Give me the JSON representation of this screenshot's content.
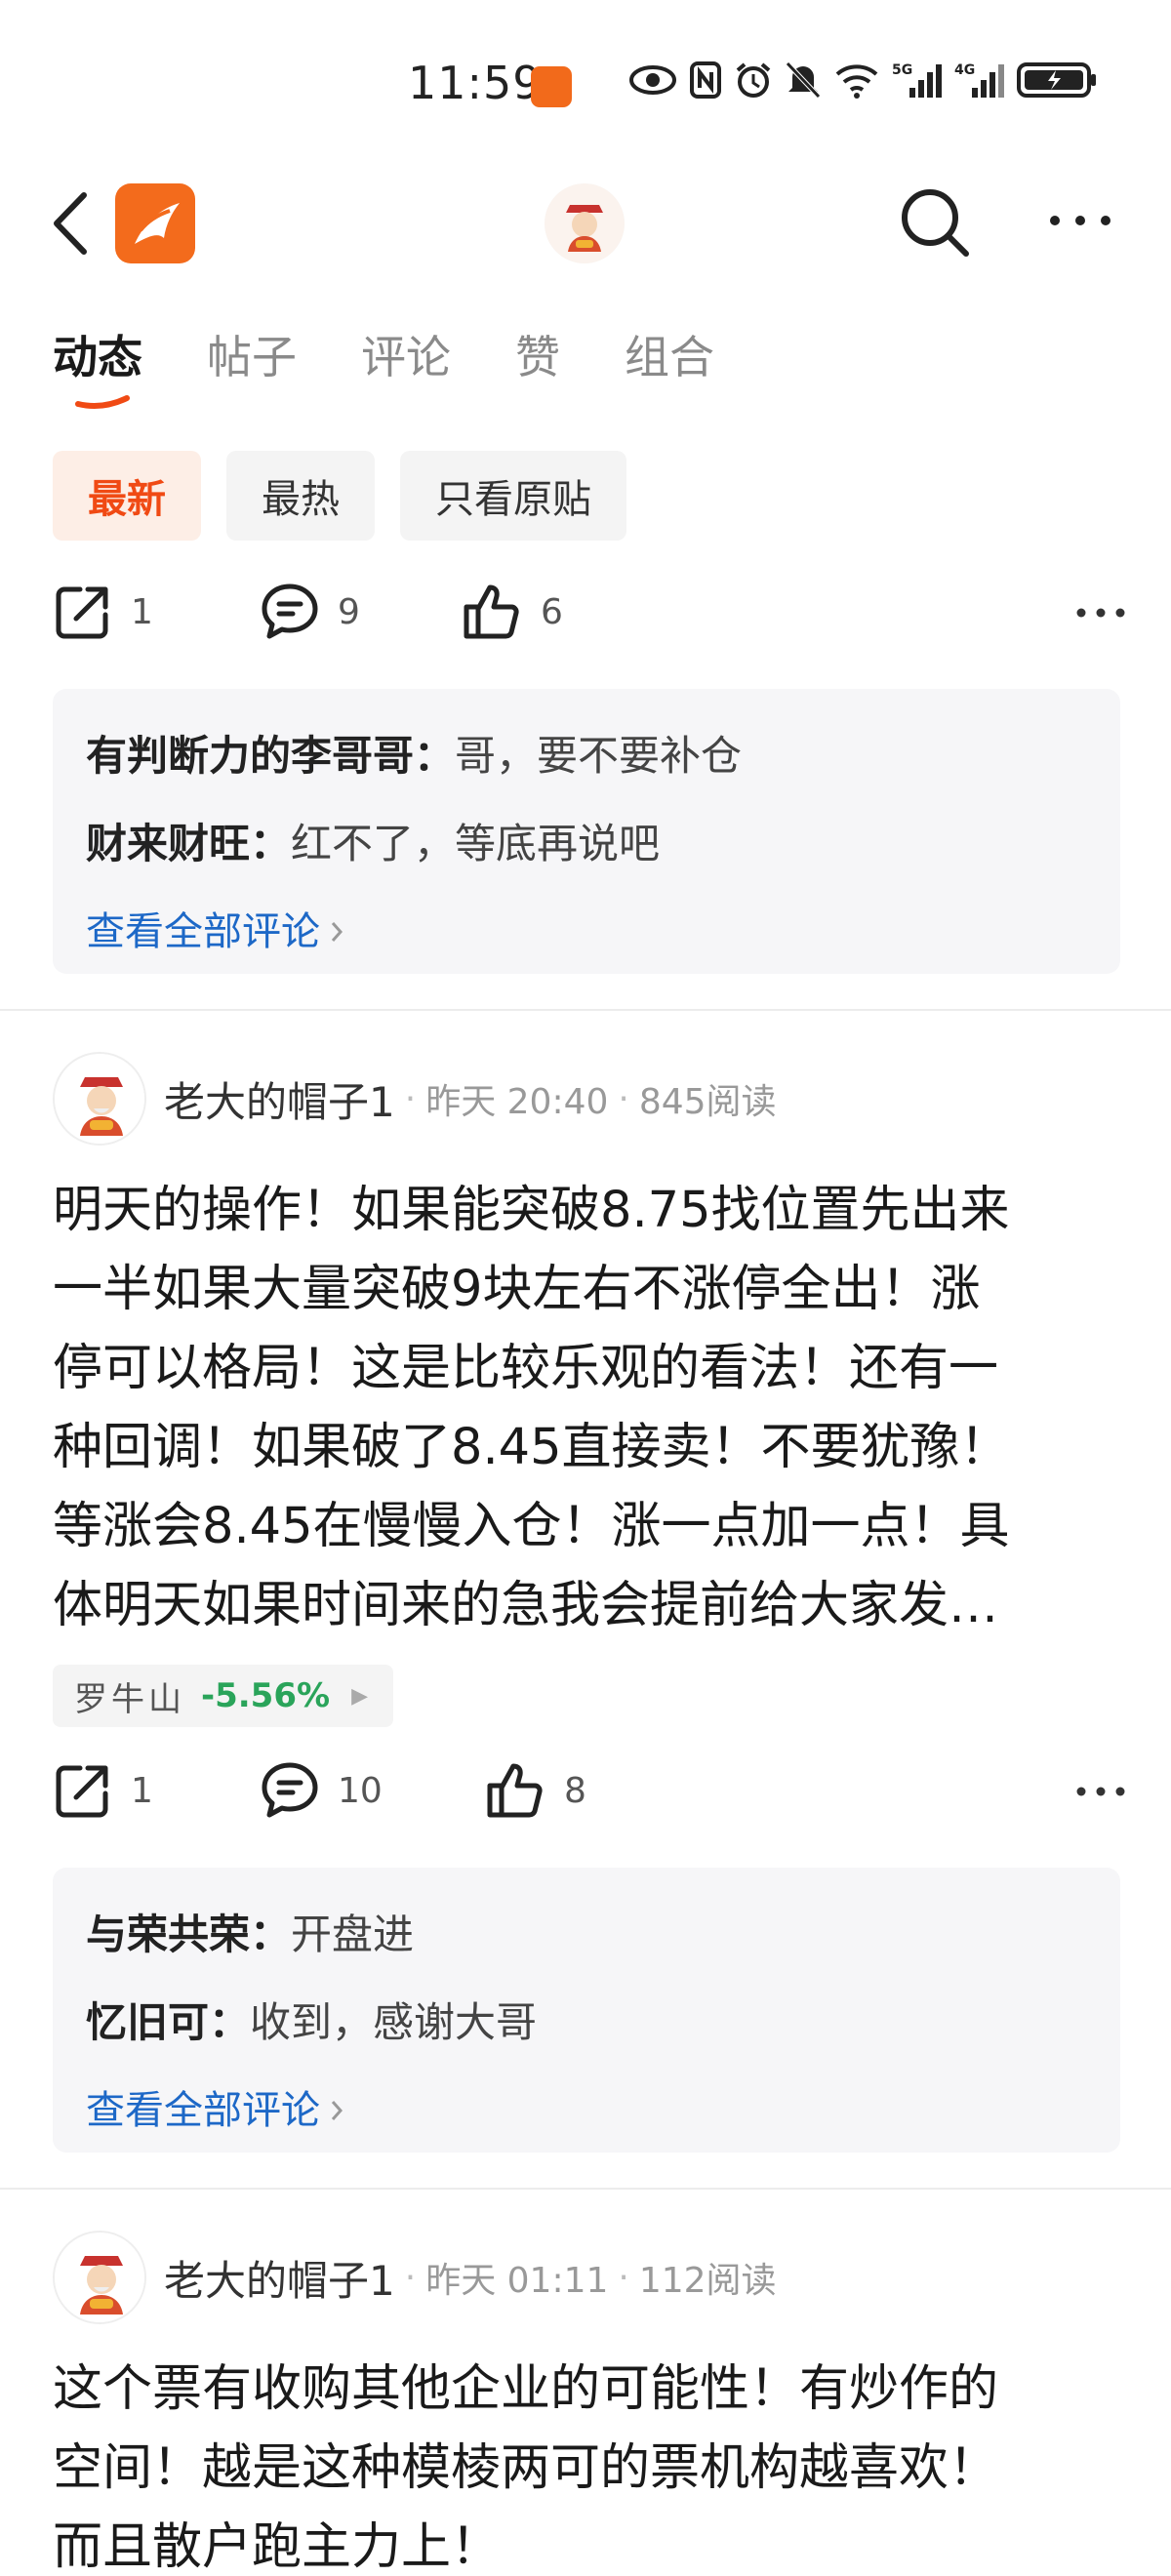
{
  "status_bar": {
    "time": "11:59",
    "app_badge": "同花顺"
  },
  "tabs": [
    "动态",
    "帖子",
    "评论",
    "赞",
    "组合"
  ],
  "filters": [
    "最新",
    "最热",
    "只看原贴"
  ],
  "post0": {
    "share_count": "1",
    "comment_count": "9",
    "like_count": "6",
    "comments": [
      {
        "name": "有判断力的李哥哥",
        "text": "哥，要不要补仓"
      },
      {
        "name": "财来财旺",
        "text": "红不了，等底再说吧"
      }
    ],
    "see_all": "查看全部评论"
  },
  "post1": {
    "author": "老大的帽子1",
    "time": "昨天 20:40",
    "reads": "845阅读",
    "lines": [
      "明天的操作！如果能突破8.75找位置先出来",
      "一半如果大量突破9块左右不涨停全出！涨",
      "停可以格局！这是比较乐观的看法！还有一",
      "种回调！如果破了8.45直接卖！不要犹豫！",
      "等涨会8.45在慢慢入仓！涨一点加一点！具",
      "体明天如果时间来的急我会提前给大家发…"
    ],
    "stock_name": "罗牛山",
    "stock_change": "-5.56%",
    "stock_change_color": "#2aa45a",
    "share_count": "1",
    "comment_count": "10",
    "like_count": "8",
    "comments": [
      {
        "name": "与荣共荣",
        "text": "开盘进"
      },
      {
        "name": "忆旧可",
        "text": "收到，感谢大哥"
      }
    ],
    "see_all": "查看全部评论"
  },
  "post2": {
    "author": "老大的帽子1",
    "time": "昨天 01:11",
    "reads": "112阅读",
    "lines": [
      "这个票有收购其他企业的可能性！有炒作的",
      "空间！越是这种模棱两可的票机构越喜欢！",
      "而且散户跑主力上！"
    ]
  },
  "colors": {
    "accent": "#f04a14",
    "link": "#1d68c7",
    "brand": "#f36b1c"
  },
  "icons": [
    "back-arrow-icon",
    "app-logo-icon",
    "search-icon",
    "more-icon",
    "share-icon",
    "comment-icon",
    "like-icon",
    "chevron-right-icon"
  ]
}
